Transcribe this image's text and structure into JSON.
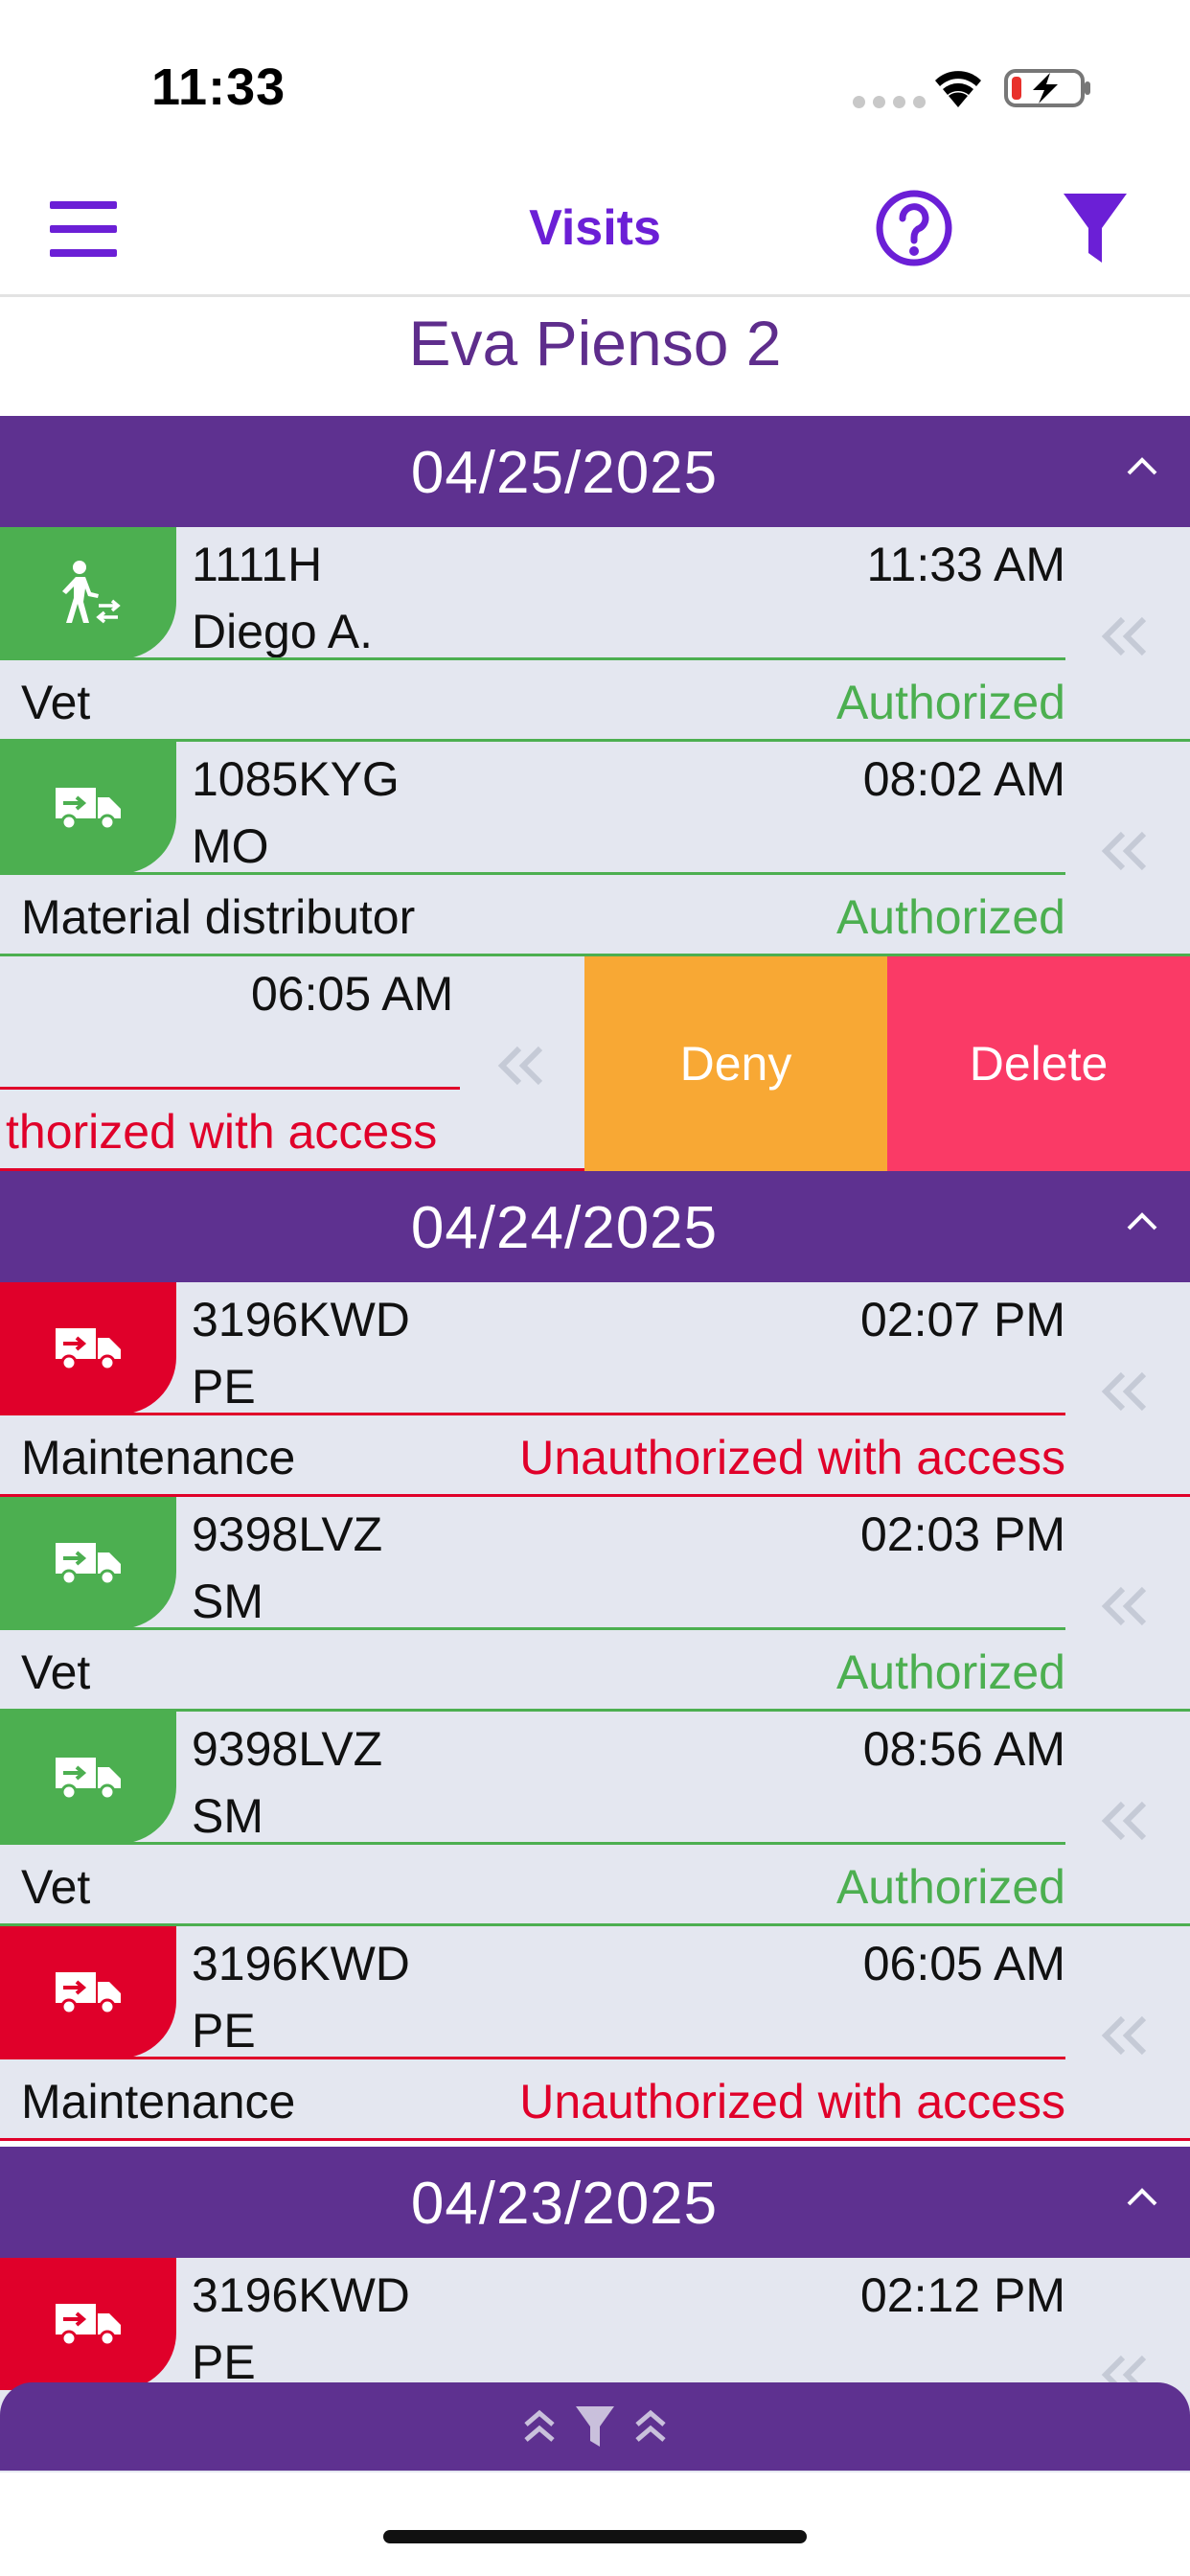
{
  "status_bar": {
    "time": "11:33"
  },
  "nav": {
    "title": "Visits"
  },
  "farm": {
    "name": "Eva Pienso 2"
  },
  "colors": {
    "purple": "#5e3190",
    "accent": "#6b1fd6",
    "authorized": "#4caf50",
    "unauthorized": "#e0002a",
    "deny": "#f8a834",
    "delete": "#fa3a66"
  },
  "groups": [
    {
      "date": "04/25/2025"
    },
    {
      "date": "04/24/2025"
    },
    {
      "date": "04/23/2025"
    }
  ],
  "visits": [
    {
      "plate": "1111H",
      "driver": "Diego A.",
      "time": "11:33 AM",
      "reason": "Vet",
      "status": "Authorized",
      "icon": "pedestrian-icon"
    },
    {
      "plate": "1085KYG",
      "driver": "MO",
      "time": "08:02 AM",
      "reason": "Material distributor",
      "status": "Authorized",
      "icon": "truck-icon"
    },
    {
      "time": "06:05 AM",
      "status_visible": "thorized with access",
      "icon": "truck-icon"
    },
    {
      "plate": "3196KWD",
      "driver": "PE",
      "time": "02:07 PM",
      "reason": "Maintenance",
      "status": "Unauthorized with access",
      "icon": "truck-icon"
    },
    {
      "plate": "9398LVZ",
      "driver": "SM",
      "time": "02:03 PM",
      "reason": "Vet",
      "status": "Authorized",
      "icon": "truck-icon"
    },
    {
      "plate": "9398LVZ",
      "driver": "SM",
      "time": "08:56 AM",
      "reason": "Vet",
      "status": "Authorized",
      "icon": "truck-icon"
    },
    {
      "plate": "3196KWD",
      "driver": "PE",
      "time": "06:05 AM",
      "reason": "Maintenance",
      "status": "Unauthorized with access",
      "icon": "truck-icon"
    },
    {
      "plate": "3196KWD",
      "driver": "PE",
      "time": "02:12 PM",
      "icon": "truck-icon"
    }
  ],
  "actions": {
    "deny": "Deny",
    "delete": "Delete"
  }
}
